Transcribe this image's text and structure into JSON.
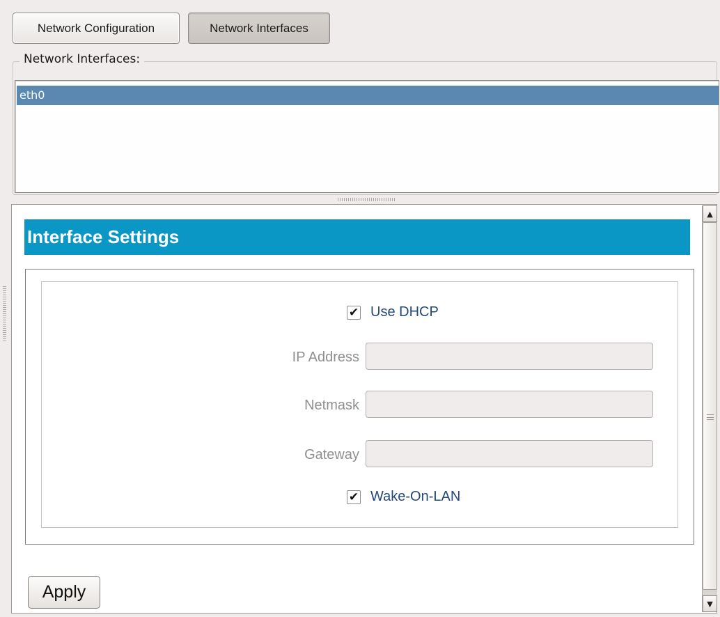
{
  "tabs": [
    {
      "label": "Network Configuration",
      "active": false
    },
    {
      "label": "Network Interfaces",
      "active": true
    }
  ],
  "interfaces_group": {
    "legend": "Network Interfaces:",
    "items": [
      {
        "label": "eth0",
        "selected": true
      }
    ]
  },
  "settings": {
    "title": "Interface Settings",
    "use_dhcp": {
      "label": "Use DHCP",
      "checked": true
    },
    "ip_address": {
      "label": "IP Address",
      "value": ""
    },
    "netmask": {
      "label": "Netmask",
      "value": ""
    },
    "gateway": {
      "label": "Gateway",
      "value": ""
    },
    "wake_on_lan": {
      "label": "Wake-On-LAN",
      "checked": true
    }
  },
  "apply_label": "Apply",
  "glyphs": {
    "check": "✔",
    "arrow_up": "▲",
    "arrow_down": "▼"
  },
  "colors": {
    "selection": "#5a88b0",
    "header": "#0b97c5",
    "check_label": "#23497c"
  }
}
